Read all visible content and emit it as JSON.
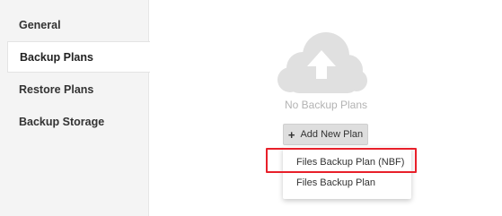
{
  "sidebar": {
    "items": [
      {
        "label": "General"
      },
      {
        "label": "Backup Plans"
      },
      {
        "label": "Restore Plans"
      },
      {
        "label": "Backup Storage"
      }
    ]
  },
  "main": {
    "empty_icon": "cloud-upload-icon",
    "empty_text": "No Backup Plans",
    "add_button": {
      "icon": "plus-icon",
      "label": "Add New Plan"
    },
    "dropdown": {
      "items": [
        {
          "label": "Files Backup Plan (NBF)"
        },
        {
          "label": "Files Backup Plan"
        }
      ]
    }
  },
  "colors": {
    "highlight": "#e8202a",
    "sidebar_bg": "#f4f4f4",
    "icon": "#e0e0e0",
    "button_bg": "#dedede"
  }
}
